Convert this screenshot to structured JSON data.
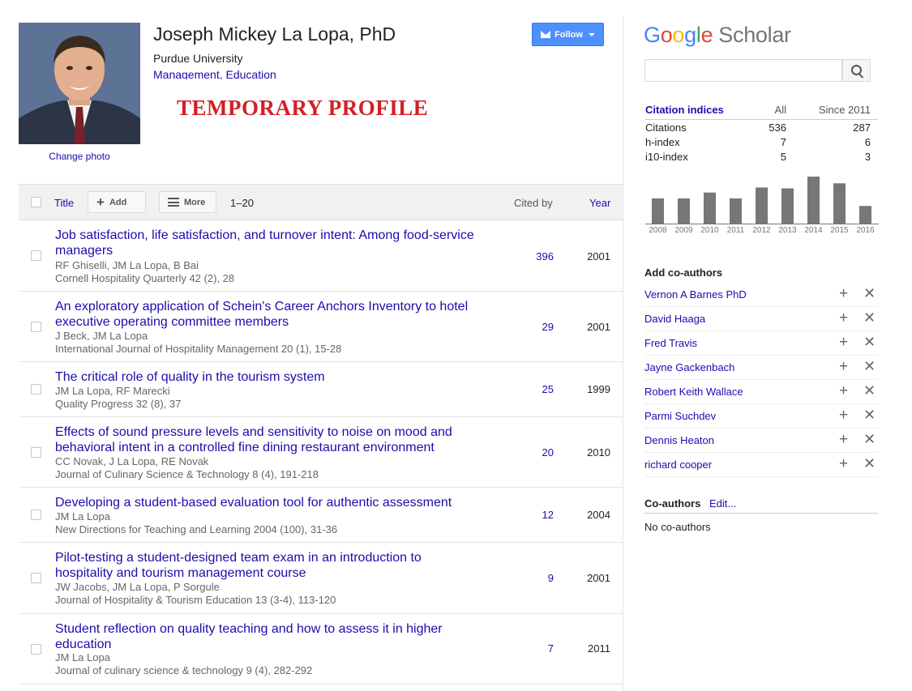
{
  "profile": {
    "name": "Joseph Mickey La Lopa, PhD",
    "affiliation": "Purdue University",
    "interests": [
      "Management",
      "Education"
    ],
    "interest_sep": ", ",
    "change_photo": "Change photo",
    "overlay": "TEMPORARY PROFILE",
    "follow_label": "Follow"
  },
  "table": {
    "title_col": "Title",
    "add_label": "Add",
    "more_label": "More",
    "range": "1–20",
    "cited_col": "Cited by",
    "year_col": "Year"
  },
  "articles": [
    {
      "title": "Job satisfaction, life satisfaction, and turnover intent: Among food-service managers",
      "authors": "RF Ghiselli, JM La Lopa, B Bai",
      "venue": "Cornell Hospitality Quarterly 42 (2), 28",
      "cited": "396",
      "year": "2001"
    },
    {
      "title": "An exploratory application of Schein's Career Anchors Inventory to hotel executive operating committee members",
      "authors": "J Beck, JM La Lopa",
      "venue": "International Journal of Hospitality Management 20 (1), 15-28",
      "cited": "29",
      "year": "2001"
    },
    {
      "title": "The critical role of quality in the tourism system",
      "authors": "JM La Lopa, RF Marecki",
      "venue": "Quality Progress 32 (8), 37",
      "cited": "25",
      "year": "1999"
    },
    {
      "title": "Effects of sound pressure levels and sensitivity to noise on mood and behavioral intent in a controlled fine dining restaurant environment",
      "authors": "CC Novak, J La Lopa, RE Novak",
      "venue": "Journal of Culinary Science & Technology 8 (4), 191-218",
      "cited": "20",
      "year": "2010"
    },
    {
      "title": "Developing a student-based evaluation tool for authentic assessment",
      "authors": "JM La Lopa",
      "venue": "New Directions for Teaching and Learning 2004 (100), 31-36",
      "cited": "12",
      "year": "2004"
    },
    {
      "title": "Pilot-testing a student-designed team exam in an introduction to hospitality and tourism management course",
      "authors": "JW Jacobs, JM La Lopa, P Sorgule",
      "venue": "Journal of Hospitality & Tourism Education 13 (3-4), 113-120",
      "cited": "9",
      "year": "2001"
    },
    {
      "title": "Student reflection on quality teaching and how to assess it in higher education",
      "authors": "JM La Lopa",
      "venue": "Journal of culinary science & technology 9 (4), 282-292",
      "cited": "7",
      "year": "2011"
    }
  ],
  "sidebar": {
    "logo_google": [
      "G",
      "o",
      "o",
      "g",
      "l",
      "e"
    ],
    "logo_scholar": "Scholar",
    "search_value": "",
    "citation_indices": {
      "header": "Citation indices",
      "col_all": "All",
      "col_since": "Since 2011",
      "rows": [
        {
          "label": "Citations",
          "all": "536",
          "since": "287"
        },
        {
          "label": "h-index",
          "all": "7",
          "since": "6"
        },
        {
          "label": "i10-index",
          "all": "5",
          "since": "3"
        }
      ]
    },
    "add_coauthors_title": "Add co-authors",
    "coauthor_suggestions": [
      "Vernon A Barnes PhD",
      "David Haaga",
      "Fred Travis",
      "Jayne Gackenbach",
      "Robert Keith Wallace",
      "Parmi Suchdev",
      "Dennis Heaton",
      "richard cooper"
    ],
    "add_symbol": "+",
    "remove_symbol": "✕",
    "coauthors_title": "Co-authors",
    "edit_label": "Edit...",
    "no_coauthors": "No co-authors"
  },
  "chart_data": {
    "type": "bar",
    "categories": [
      "2008",
      "2009",
      "2010",
      "2011",
      "2012",
      "2013",
      "2014",
      "2015",
      "2016"
    ],
    "values": [
      30,
      30,
      37,
      30,
      43,
      42,
      56,
      48,
      21
    ],
    "bar_color": "#777777"
  },
  "colors": {
    "link": "#1a0dab",
    "follow_button": "#4d90fe",
    "overlay_text": "#d31f26"
  }
}
